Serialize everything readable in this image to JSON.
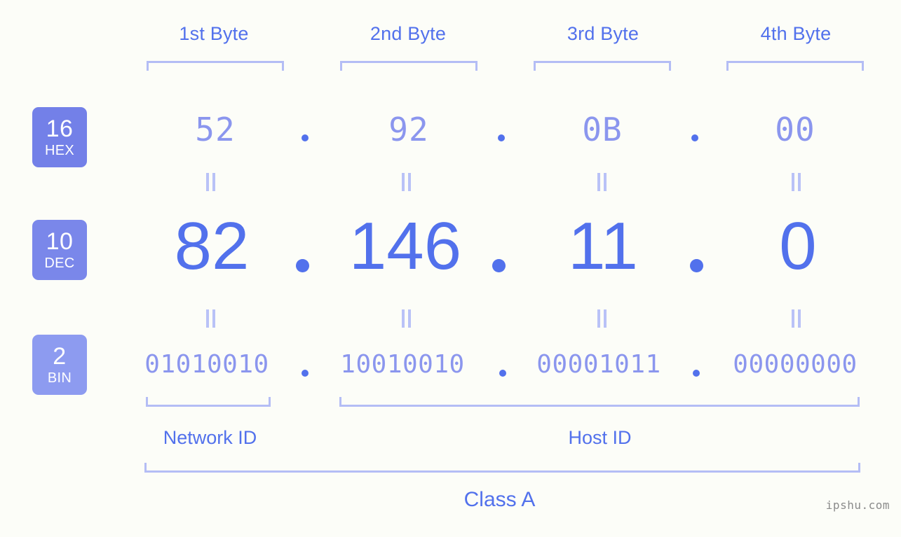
{
  "meta": {
    "background_color": "#fcfdf8",
    "accent_color": "#5271ec",
    "light_accent_color": "#8b96ee",
    "bracket_color": "#b4bdf5",
    "badge_color_hex": "#7380e8",
    "badge_color_dec": "#7a87ea",
    "badge_color_bin": "#8d9bf0",
    "watermark": "ipshu.com"
  },
  "byte_headers": [
    {
      "label": "1st Byte"
    },
    {
      "label": "2nd Byte"
    },
    {
      "label": "3rd Byte"
    },
    {
      "label": "4th Byte"
    }
  ],
  "bases": [
    {
      "number": "16",
      "abbr": "HEX"
    },
    {
      "number": "10",
      "abbr": "DEC"
    },
    {
      "number": "2",
      "abbr": "BIN"
    }
  ],
  "rows": {
    "hex": {
      "base_number": "16",
      "base_abbr": "HEX",
      "values": [
        "52",
        "92",
        "0B",
        "00"
      ]
    },
    "dec": {
      "base_number": "10",
      "base_abbr": "DEC",
      "values": [
        "82",
        "146",
        "11",
        "0"
      ]
    },
    "bin": {
      "base_number": "2",
      "base_abbr": "BIN",
      "values": [
        "01010010",
        "10010010",
        "00001011",
        "00000000"
      ]
    }
  },
  "separator": ".",
  "equals_symbol": "=",
  "sections": {
    "network_id": "Network ID",
    "host_id": "Host ID",
    "class": "Class A"
  },
  "chart_data": {
    "type": "table",
    "title": "IP Address Byte Breakdown",
    "ip_decimal": "82.146.11.0",
    "ip_hex": "52.92.0B.00",
    "ip_binary": "01010010.10010010.00001011.00000000",
    "ip_class": "Class A",
    "network_id_bytes": 1,
    "host_id_bytes": 3,
    "categories": [
      "1st Byte",
      "2nd Byte",
      "3rd Byte",
      "4th Byte"
    ],
    "series": [
      {
        "name": "HEX",
        "values": [
          "52",
          "92",
          "0B",
          "00"
        ]
      },
      {
        "name": "DEC",
        "values": [
          "82",
          "146",
          "11",
          "0"
        ]
      },
      {
        "name": "BIN",
        "values": [
          "01010010",
          "10010010",
          "00001011",
          "00000000"
        ]
      }
    ]
  }
}
